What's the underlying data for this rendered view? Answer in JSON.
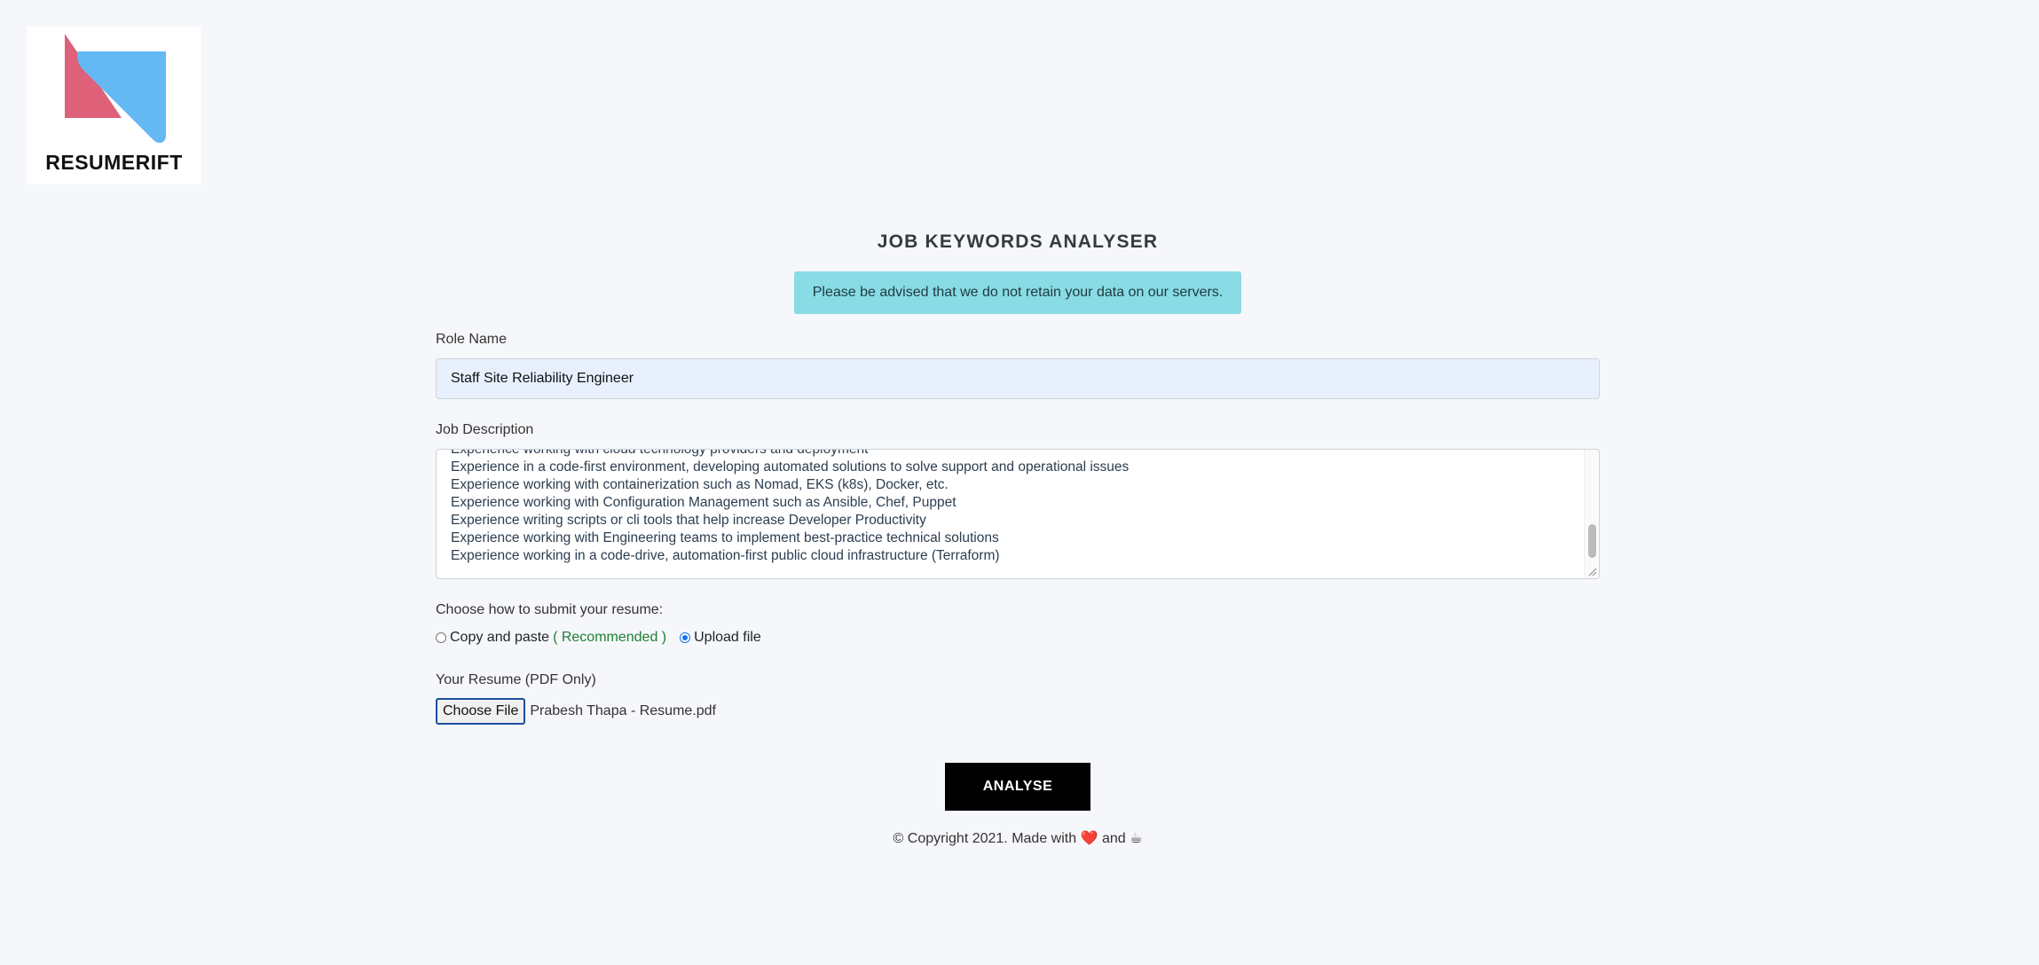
{
  "brand": {
    "name": "RESUMERIFT",
    "colors": {
      "pink": "#de6079",
      "blue": "#64b9f3"
    }
  },
  "page": {
    "title": "JOB KEYWORDS ANALYSER",
    "notice": "Please be advised that we do not retain your data on our servers."
  },
  "form": {
    "role_label": "Role Name",
    "role_value": "Staff Site Reliability Engineer",
    "description_label": "Job Description",
    "description_lines": [
      "Experience working with cloud technology providers and deployment",
      "Experience in a code-first environment, developing automated solutions to solve support and operational issues",
      "Experience working with containerization such as Nomad, EKS (k8s), Docker, etc.",
      "Experience working with Configuration Management such as Ansible, Chef, Puppet",
      "Experience writing scripts or cli tools that help increase Developer Productivity",
      "Experience working with Engineering teams to implement best-practice technical solutions",
      "Experience working in a code-drive, automation-first public cloud infrastructure (Terraform)"
    ],
    "submit_method_label": "Choose how to submit your resume:",
    "option_paste": "Copy and paste",
    "option_paste_hint": "( Recommended )",
    "option_upload": "Upload file",
    "selected_option": "Upload file",
    "resume_label": "Your Resume (PDF Only)",
    "choose_file_label": "Choose File",
    "file_name": "Prabesh Thapa - Resume.pdf",
    "submit_label": "ANALYSE"
  },
  "footer": {
    "text_before": "© Copyright 2021. Made with",
    "heart": "❤️",
    "and": "and",
    "coffee": "☕"
  }
}
